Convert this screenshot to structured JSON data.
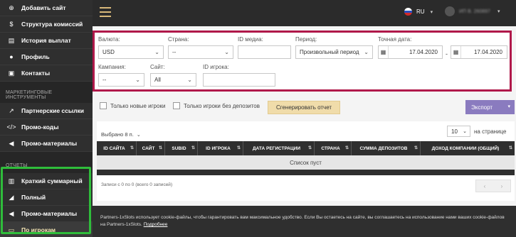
{
  "sidebar": {
    "top_items": [
      {
        "icon": "plus-circle-icon",
        "label": "Добавить сайт"
      },
      {
        "icon": "dollar-icon",
        "label": "Структура комиссий"
      },
      {
        "icon": "wallet-icon",
        "label": "История выплат"
      },
      {
        "icon": "user-icon",
        "label": "Профиль"
      },
      {
        "icon": "contacts-icon",
        "label": "Контакты"
      }
    ],
    "section_marketing": "МАРКЕТИНГОВЫЕ ИНСТРУМЕНТЫ",
    "marketing_items": [
      {
        "icon": "external-link-icon",
        "label": "Партнерские ссылки"
      },
      {
        "icon": "code-icon",
        "label": "Промо-коды"
      },
      {
        "icon": "megaphone-icon",
        "label": "Промо-материалы"
      }
    ],
    "section_reports": "ОТЧЕТЫ",
    "report_items": [
      {
        "icon": "bar-chart-icon",
        "label": "Краткий суммарный"
      },
      {
        "icon": "area-chart-icon",
        "label": "Полный"
      },
      {
        "icon": "megaphone-icon",
        "label": "Промо-материалы"
      },
      {
        "icon": "id-card-icon",
        "label": "По игрокам"
      }
    ],
    "highlight_color": "#2fbd3b"
  },
  "header": {
    "language": "RU",
    "user_name": "ИП В. 260897"
  },
  "filters": {
    "currency": {
      "label": "Валюта:",
      "value": "USD"
    },
    "country": {
      "label": "Страна:",
      "value": "--"
    },
    "media_id": {
      "label": "ID медиа:",
      "value": ""
    },
    "period": {
      "label": "Период:",
      "value": "Произвольный период"
    },
    "exact_date": {
      "label": "Точная дата:",
      "from": "17.04.2020",
      "to": "17.04.2020",
      "separator": "-"
    },
    "campaign": {
      "label": "Кампания:",
      "value": "--"
    },
    "site": {
      "label": "Сайт:",
      "value": "All"
    },
    "player_id": {
      "label": "ID игрока:",
      "value": ""
    },
    "border_color": "#b0184a"
  },
  "options": {
    "only_new_players": "Только новые игроки",
    "only_no_deposits": "Только игроки без депозитов",
    "generate_button": "Сгенерировать отчет",
    "export_button": "Экспорт"
  },
  "table": {
    "chosen_label": "Выбрано 8 п.",
    "per_page_value": "10",
    "per_page_label": "на странице",
    "columns": [
      "ID САЙТА",
      "САЙТ",
      "SUBID",
      "ID ИГРОКА",
      "ДАТА РЕГИСТРАЦИИ",
      "СТРАНА",
      "СУММА ДЕПОЗИТОВ",
      "ДОХОД КОМПАНИИ (ОБЩИЙ)"
    ],
    "empty_text": "Список пуст",
    "records_text": "Записи с 0 по 0 (всего 0 записей)",
    "prev": "‹",
    "next": "›"
  },
  "cookie": {
    "text": "Partners-1xSlots использует cookie-файлы, чтобы гарантировать вам максимальное удобство. Если Вы остаетесь на сайте, вы соглашаетесь на использование нами ваших cookie-файлов на Partners-1xSlots.",
    "link": "Подробнее"
  }
}
